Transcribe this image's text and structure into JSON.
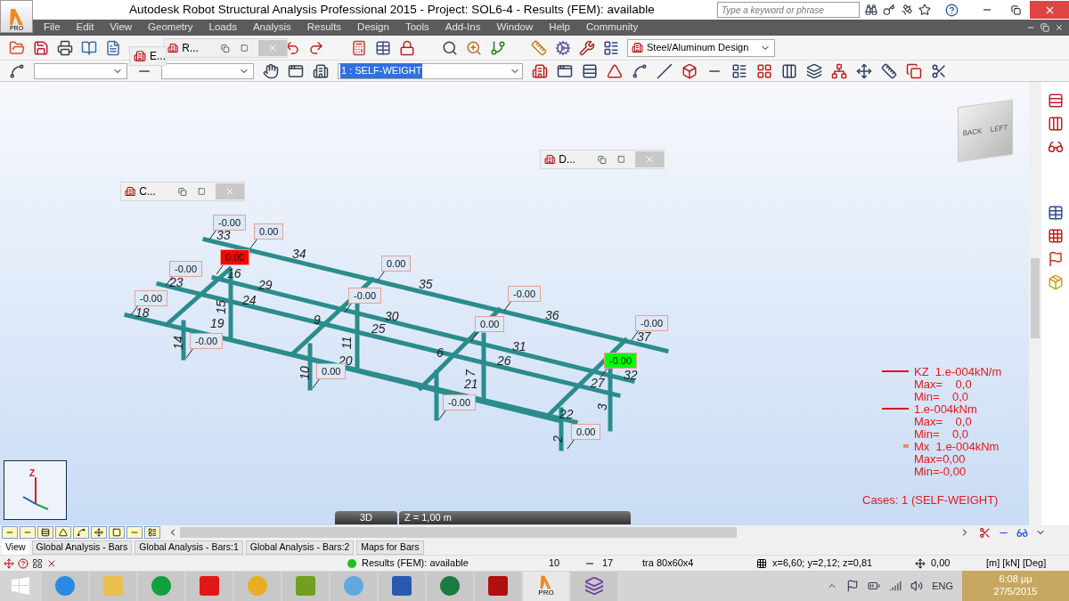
{
  "window": {
    "title": "Autodesk Robot Structural Analysis Professional 2015 - Project: SOL6-4 - Results (FEM): available",
    "logo_text": "PRO"
  },
  "search": {
    "placeholder": "Type a keyword or phrase"
  },
  "menu": [
    "File",
    "Edit",
    "View",
    "Geometry",
    "Loads",
    "Analysis",
    "Results",
    "Design",
    "Tools",
    "Add-Ins",
    "Window",
    "Help",
    "Community"
  ],
  "toolbar": {
    "layout_select": "Steel/Aluminum Design",
    "load_case_select": "1 : SELF-WEIGHT"
  },
  "minimized_windows": [
    {
      "title": "E..."
    },
    {
      "title": "R..."
    }
  ],
  "viewport": {
    "floating_windows": [
      {
        "title": "C..."
      },
      {
        "title": "D..."
      }
    ],
    "view_cube": [
      "BACK",
      "LEFT"
    ],
    "axis_label": "Z",
    "value_labels": [
      {
        "text": "-0.00",
        "color": "#dce9f8"
      },
      {
        "text": "0.00",
        "color": "#dce9f8"
      },
      {
        "text": "0.00",
        "color": "#ff0000"
      },
      {
        "text": "0.00",
        "color": "#dce9f8"
      },
      {
        "text": "-0.00",
        "color": "#dce9f8"
      },
      {
        "text": "-0.00",
        "color": "#dce9f8"
      },
      {
        "text": "-0.00",
        "color": "#dce9f8"
      },
      {
        "text": "-0.00",
        "color": "#dce9f8"
      },
      {
        "text": "0.00",
        "color": "#dce9f8"
      },
      {
        "text": "-0.00",
        "color": "#dce9f8"
      },
      {
        "text": "-0.00",
        "color": "#dce9f8"
      },
      {
        "text": "-0.00",
        "color": "#00ff00"
      },
      {
        "text": "0.00",
        "color": "#dce9f8"
      },
      {
        "text": "-0.00",
        "color": "#dce9f8"
      },
      {
        "text": "0.00",
        "color": "#dce9f8"
      }
    ],
    "member_numbers": [
      "33",
      "34",
      "23",
      "29",
      "24",
      "35",
      "18",
      "15",
      "30",
      "25",
      "36",
      "9",
      "19",
      "14",
      "11",
      "31",
      "37",
      "20",
      "26",
      "6",
      "10",
      "7",
      "27",
      "32",
      "21",
      "3",
      "22",
      "2",
      "16"
    ],
    "legend": [
      {
        "kind": "line",
        "text": "KZ  1.e-004kN/m"
      },
      {
        "kind": "plain",
        "text": "Max=    0,0"
      },
      {
        "kind": "plain",
        "text": "Min=    0,0"
      },
      {
        "kind": "line",
        "text": "1.e-004kNm"
      },
      {
        "kind": "plain",
        "text": "Max=    0,0"
      },
      {
        "kind": "plain",
        "text": "Min=    0,0"
      },
      {
        "kind": "mark",
        "text": "Mx  1.e-004kNm"
      },
      {
        "kind": "plain",
        "text": "Max=0,00"
      },
      {
        "kind": "plain",
        "text": "Min=-0,00"
      }
    ],
    "cases": "Cases: 1 (SELF-WEIGHT)",
    "view_mode": "3D",
    "z_level": "Z = 1,00 m"
  },
  "tabs": [
    {
      "label": "View",
      "selected": true
    },
    {
      "label": "Global Analysis - Bars",
      "selected": false
    },
    {
      "label": "Global Analysis - Bars:1",
      "selected": false
    },
    {
      "label": "Global Analysis - Bars:2",
      "selected": false
    },
    {
      "label": "Maps for Bars",
      "selected": false
    }
  ],
  "status_bar": {
    "status": "Results (FEM): available",
    "nodes": "10",
    "bars": "17",
    "section": "tra 80x60x4",
    "coordinates": "x=6,60; y=2,12; z=0,81",
    "angle": "0,00",
    "units": "[m] [kN] [Deg]"
  },
  "taskbar": {
    "language": "ENG",
    "time": "6:08 μμ",
    "date": "27/5/2015",
    "app_badge": "PRO"
  }
}
